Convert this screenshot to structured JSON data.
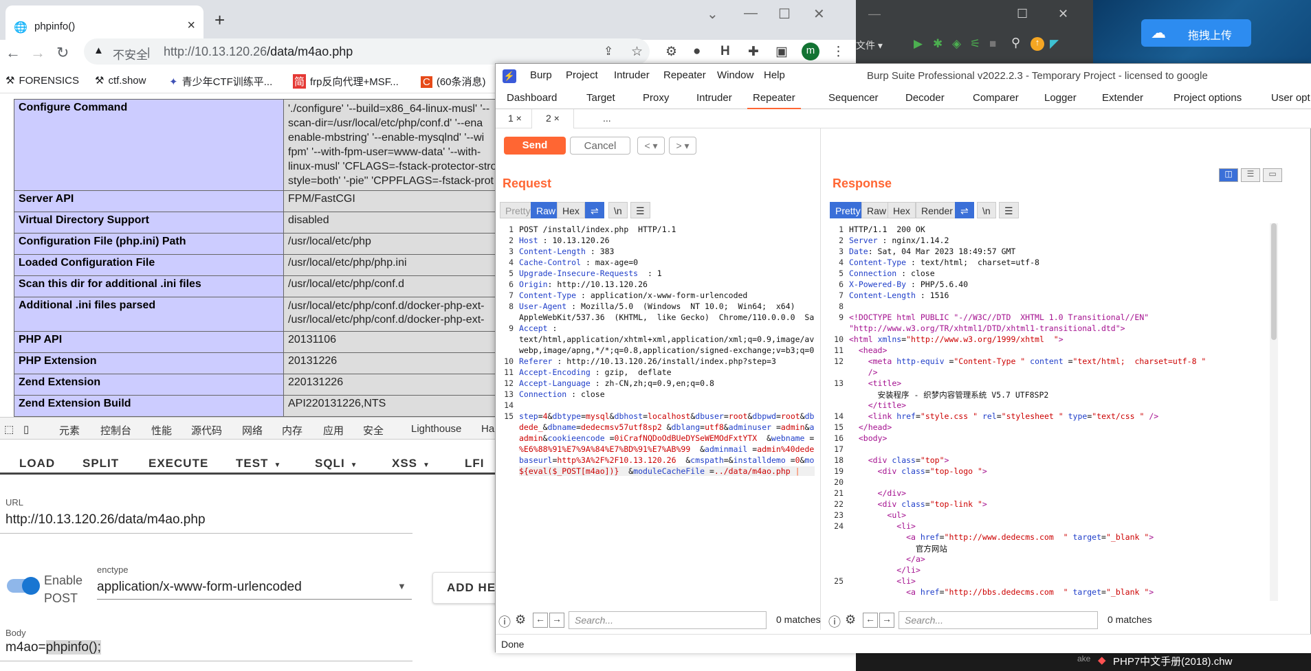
{
  "chrome": {
    "tab_title": "phpinfo()",
    "new_tab": "+",
    "insecure_label": "不安全",
    "url_host": "http://10.13.120.26",
    "url_path": "/data/m4ao.php",
    "profile_initial": "m",
    "bookmarks": [
      {
        "icon": "⚒",
        "label": "FORENSICS"
      },
      {
        "icon": "⚒",
        "label": "ctf.show"
      },
      {
        "icon": "✦",
        "label": "青少年CTF训练平..."
      },
      {
        "icon": "简",
        "label": "frp反向代理+MSF..."
      },
      {
        "icon": "C",
        "label": "(60条消息)"
      }
    ]
  },
  "phpinfo": {
    "rows": [
      {
        "k": "Configure Command",
        "v": "'./configure' '--build=x86_64-linux-musl' '--\nscan-dir=/usr/local/etc/php/conf.d' '--ena\nenable-mbstring' '--enable-mysqlnd' '--wi\nfpm' '--with-fpm-user=www-data' '--with-\nlinux-musl' 'CFLAGS=-fstack-protector-stro\nstyle=both' '-pie'' 'CPPFLAGS=-fstack-prot"
      },
      {
        "k": "Server API",
        "v": "FPM/FastCGI"
      },
      {
        "k": "Virtual Directory Support",
        "v": "disabled"
      },
      {
        "k": "Configuration File (php.ini) Path",
        "v": "/usr/local/etc/php"
      },
      {
        "k": "Loaded Configuration File",
        "v": "/usr/local/etc/php/php.ini"
      },
      {
        "k": "Scan this dir for additional .ini files",
        "v": "/usr/local/etc/php/conf.d"
      },
      {
        "k": "Additional .ini files parsed",
        "v": "/usr/local/etc/php/conf.d/docker-php-ext-\n/usr/local/etc/php/conf.d/docker-php-ext-"
      },
      {
        "k": "PHP API",
        "v": "20131106"
      },
      {
        "k": "PHP Extension",
        "v": "20131226"
      },
      {
        "k": "Zend Extension",
        "v": "220131226"
      },
      {
        "k": "Zend Extension Build",
        "v": "API220131226,NTS"
      }
    ]
  },
  "devtools": {
    "tabs": [
      "元素",
      "控制台",
      "性能",
      "源代码",
      "网络",
      "内存",
      "应用",
      "安全",
      "Lighthouse",
      "Ha"
    ]
  },
  "hackbar": {
    "buttons": [
      "LOAD",
      "SPLIT",
      "EXECUTE",
      "TEST",
      "SQLI",
      "XSS",
      "LFI"
    ],
    "url_label": "URL",
    "url_value": "http://10.13.120.26/data/m4ao.php",
    "enable_post": "Enable\nPOST",
    "enctype_label": "enctype",
    "enctype_value": "application/x-www-form-urlencoded",
    "add_header": "ADD HE",
    "body_label": "Body",
    "body_prefix": "m4ao=",
    "body_highlight": "phpinfo();"
  },
  "ide": {
    "file_label": "文件"
  },
  "sky_app": {
    "upload_label": "拖拽上传"
  },
  "taskbar": {
    "item": "PHP7中文手册(2018).chw",
    "side": "ake"
  },
  "burp": {
    "menus": [
      "Burp",
      "Project",
      "Intruder",
      "Repeater",
      "Window",
      "Help"
    ],
    "title": "Burp Suite Professional v2022.2.3 - Temporary Project - licensed to google",
    "tabs": [
      "Dashboard",
      "Target",
      "Proxy",
      "Intruder",
      "Repeater",
      "Sequencer",
      "Decoder",
      "Comparer",
      "Logger",
      "Extender",
      "Project options",
      "User opt"
    ],
    "active_tab": "Repeater",
    "subtabs": [
      "1 ×",
      "2 ×",
      "..."
    ],
    "send": "Send",
    "cancel": "Cancel",
    "request_title": "Request",
    "response_title": "Response",
    "request_views": [
      "Pretty",
      "Raw",
      "Hex"
    ],
    "response_views": [
      "Pretty",
      "Raw",
      "Hex",
      "Render"
    ],
    "search_placeholder": "Search...",
    "matches": "0 matches",
    "status": "Done"
  }
}
